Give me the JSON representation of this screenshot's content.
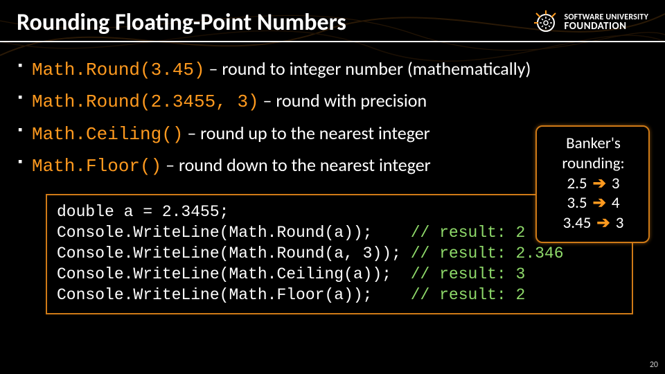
{
  "header": {
    "title": "Rounding Floating-Point Numbers",
    "logo": {
      "line1": "SOFTWARE UNIVERSITY",
      "line2": "FOUNDATION"
    }
  },
  "bullets": [
    {
      "code": "Math.Round(3.45)",
      "rest": " – round to integer number (mathematically)"
    },
    {
      "code": "Math.Round(2.3455, 3)",
      "rest": " – round with precision"
    },
    {
      "code": "Math.Ceiling()",
      "rest": " – round up to the nearest integer"
    },
    {
      "code": "Math.Floor()",
      "rest": " – round down to the nearest integer"
    }
  ],
  "callout": {
    "line1": "Banker's",
    "line2": "rounding:",
    "rows": [
      {
        "a": "2.5",
        "b": "3"
      },
      {
        "a": "3.5",
        "b": "4"
      },
      {
        "a": "3.45",
        "b": "3"
      }
    ]
  },
  "code": {
    "l1": "double a = 2.3455;",
    "l2": {
      "stmt": "Console.WriteLine(Math.Round(a));   ",
      "cmt": "// result: 2"
    },
    "l3": {
      "stmt": "Console.WriteLine(Math.Round(a, 3));",
      "cmt": "// result: 2.346"
    },
    "l4": {
      "stmt": "Console.WriteLine(Math.Ceiling(a)); ",
      "cmt": "// result: 3"
    },
    "l5": {
      "stmt": "Console.WriteLine(Math.Floor(a));   ",
      "cmt": "// result: 2"
    }
  },
  "page_number": "20"
}
